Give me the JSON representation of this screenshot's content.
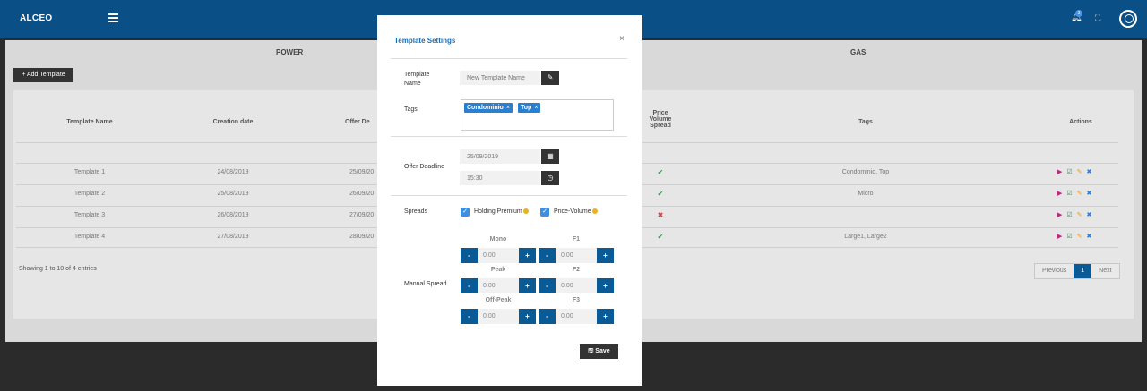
{
  "app": {
    "brand": "ALCEO",
    "notification_count": "3"
  },
  "sections": {
    "power": "POWER",
    "gas": "GAS"
  },
  "toolbar": {
    "add_template": "+ Add Template"
  },
  "table": {
    "headers": {
      "name": "Template Name",
      "creation": "Creation date",
      "offer": "Offer De",
      "price_volume": [
        "Price",
        "Volume",
        "Spread"
      ],
      "tags": "Tags",
      "actions": "Actions"
    },
    "rows": [
      {
        "name": "Template 1",
        "creation": "24/08/2019",
        "offer": "25/09/20",
        "pv": "check",
        "tags": "Condominio, Top"
      },
      {
        "name": "Template 2",
        "creation": "25/08/2019",
        "offer": "26/09/20",
        "pv": "check",
        "tags": "Micro"
      },
      {
        "name": "Template 3",
        "creation": "26/08/2019",
        "offer": "27/09/20",
        "pv": "cross",
        "tags": ""
      },
      {
        "name": "Template 4",
        "creation": "27/08/2019",
        "offer": "28/09/20",
        "pv": "check",
        "tags": "Large1, Large2"
      }
    ],
    "info": "Showing 1 to 10 of 4 entries",
    "pager": {
      "previous": "Previous",
      "page": "1",
      "next": "Next"
    }
  },
  "modal": {
    "title": "Template Settings",
    "close": "×",
    "template_name": {
      "label_line1": "Template",
      "label_line2": "Name",
      "placeholder": "New Template Name"
    },
    "tags": {
      "label": "Tags",
      "items": [
        "Condominio",
        "Top"
      ]
    },
    "offer_deadline": {
      "label": "Offer Deadline",
      "date": "25/09/2019",
      "time": "15:30"
    },
    "spreads": {
      "label": "Spreads",
      "holding": "Holding Premium",
      "price_volume": "Price-Volume"
    },
    "manual_spread": {
      "label": "Manual Spread",
      "fields": [
        {
          "name": "Mono",
          "value": "0.00"
        },
        {
          "name": "F1",
          "value": "0.00"
        },
        {
          "name": "Peak",
          "value": "0.00"
        },
        {
          "name": "F2",
          "value": "0.00"
        },
        {
          "name": "Off-Peak",
          "value": "0.00"
        },
        {
          "name": "F3",
          "value": "0.00"
        }
      ],
      "minus": "-",
      "plus": "+"
    },
    "save": "Save"
  }
}
